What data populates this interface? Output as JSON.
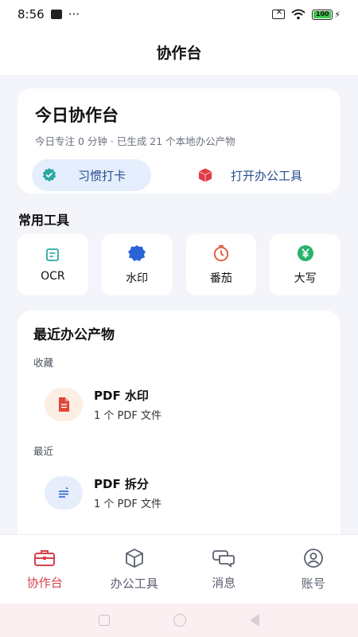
{
  "status_bar": {
    "time": "8:56",
    "more": "···",
    "battery_level": "100"
  },
  "header": {
    "title": "协作台"
  },
  "summary": {
    "title": "今日协作台",
    "subtitle": "今日专注 0 分钟 · 已生成 21 个本地办公产物",
    "habit_button": "习惯打卡",
    "open_tools_button": "打开办公工具"
  },
  "common_tools": {
    "label": "常用工具",
    "items": [
      {
        "label": "OCR",
        "icon": "ocr-scan-icon",
        "color": "#2ba7a0"
      },
      {
        "label": "水印",
        "icon": "watermark-badge-icon",
        "color": "#2a63d6"
      },
      {
        "label": "番茄",
        "icon": "timer-icon",
        "color": "#e0603f"
      },
      {
        "label": "大写",
        "icon": "yen-icon",
        "color": "#27b36a"
      }
    ]
  },
  "recent": {
    "title": "最近办公产物",
    "groups": [
      {
        "label": "收藏",
        "items": [
          {
            "name": "PDF 水印",
            "meta": "1 个 PDF 文件",
            "icon": "pdf-document-icon"
          }
        ]
      },
      {
        "label": "最近",
        "items": [
          {
            "name": "PDF 拆分",
            "meta": "1 个 PDF 文件",
            "icon": "pdf-split-icon"
          }
        ]
      }
    ]
  },
  "bottom_nav": {
    "items": [
      {
        "label": "协作台",
        "icon": "briefcase-icon",
        "active": true
      },
      {
        "label": "办公工具",
        "icon": "cube-icon",
        "active": false
      },
      {
        "label": "消息",
        "icon": "chat-bubbles-icon",
        "active": false
      },
      {
        "label": "账号",
        "icon": "account-icon",
        "active": false
      }
    ]
  },
  "colors": {
    "accent_red": "#d6404a",
    "accent_blue": "#2a4d8f",
    "background": "#f3f5fb"
  }
}
